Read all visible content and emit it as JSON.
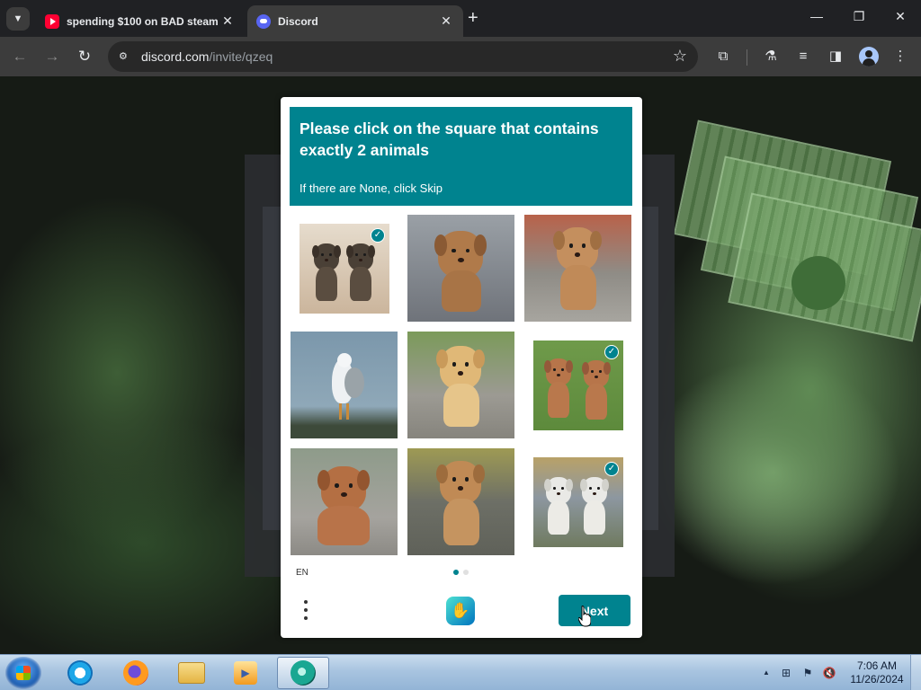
{
  "browser": {
    "tabs": [
      {
        "title": "spending $100 on BAD steam",
        "favicon": "youtube-icon",
        "active": false
      },
      {
        "title": "Discord",
        "favicon": "discord-icon",
        "active": true
      }
    ],
    "url_host": "discord.com",
    "url_path": "/invite/qzeq",
    "icons": {
      "tab_search": "chevron-down-icon",
      "close_tab": "✕",
      "new_tab": "+",
      "minimize": "—",
      "maximize": "❐",
      "close_window": "✕",
      "back": "←",
      "forward": "→",
      "reload": "↻",
      "star": "☆",
      "extensions": "⧉",
      "labs": "⚗",
      "media": "≡",
      "sidepanel": "◨",
      "menu": "⋮"
    }
  },
  "captcha": {
    "prompt_title": "Please click on the square that contains exactly 2 animals",
    "prompt_subtitle": "If there are None, click Skip",
    "language": "EN",
    "next_label": "Next",
    "accent_color": "#00838f",
    "pages": 2,
    "current_page": 1,
    "cells": [
      {
        "content": "two dark puppies",
        "selected": true
      },
      {
        "content": "one puppy on blanket",
        "selected": false
      },
      {
        "content": "one puppy outdoors",
        "selected": false
      },
      {
        "content": "seagull",
        "selected": false
      },
      {
        "content": "golden retriever puppy",
        "selected": false
      },
      {
        "content": "two puppies on grass",
        "selected": true
      },
      {
        "content": "fluffy puppy",
        "selected": false
      },
      {
        "content": "puppy on bench",
        "selected": false
      },
      {
        "content": "two white dogs",
        "selected": true
      }
    ]
  },
  "taskbar": {
    "apps": [
      "internet-explorer-icon",
      "firefox-icon",
      "file-explorer-icon",
      "media-player-icon",
      "active-app-icon"
    ],
    "time": "7:06 AM",
    "date": "11/26/2024",
    "tray": {
      "show_hidden": "▲",
      "network": "⊞",
      "flag": "⚑",
      "volume": "🔇"
    }
  }
}
